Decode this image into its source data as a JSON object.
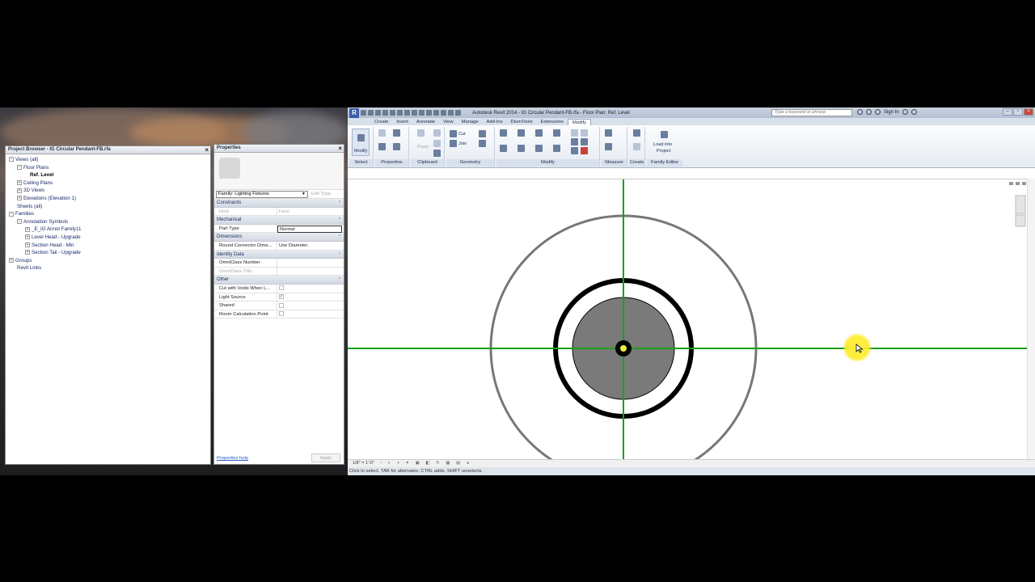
{
  "project_browser": {
    "title": "Project Browser - IG Circular Pendant-FB.rfa",
    "items": [
      {
        "label": "Views (all)",
        "exp": "−"
      },
      {
        "label": "Floor Plans",
        "exp": "−"
      },
      {
        "label": "Ref. Level",
        "exp": ""
      },
      {
        "label": "Ceiling Plans",
        "exp": "+"
      },
      {
        "label": "3D Views",
        "exp": "+"
      },
      {
        "label": "Elevations (Elevation 1)",
        "exp": "+"
      },
      {
        "label": "Sheets (all)",
        "exp": ""
      },
      {
        "label": "Families",
        "exp": "−"
      },
      {
        "label": "Annotation Symbols",
        "exp": "−"
      },
      {
        "label": "_E_IG Annot Family11",
        "exp": "+"
      },
      {
        "label": "Level Head - Upgrade",
        "exp": "+"
      },
      {
        "label": "Section Head - Min",
        "exp": "+"
      },
      {
        "label": "Section Tail - Upgrade",
        "exp": "+"
      },
      {
        "label": "Groups",
        "exp": "+"
      },
      {
        "label": "Revit Links",
        "exp": ""
      }
    ]
  },
  "properties": {
    "title": "Properties",
    "family_select": "Family: Lighting Fixtures",
    "edit_type": "Edit Type",
    "cat_constraints": "Constraints",
    "host_key": "Host",
    "host_val": "Face",
    "cat_mechanical": "Mechanical",
    "part_type_key": "Part Type",
    "part_type_val": "Normal",
    "cat_dimensions": "Dimensions",
    "round_key": "Round Connector Dime...",
    "round_val": "Use Diameter",
    "cat_identity": "Identity Data",
    "omni_num_key": "OmniClass Number",
    "omni_title_key": "OmniClass Title",
    "cat_other": "Other",
    "cut_voids_key": "Cut with Voids When L...",
    "light_source_key": "Light Source",
    "shared_key": "Shared",
    "room_calc_key": "Room Calculation Point",
    "help_link": "Properties help",
    "apply": "Apply"
  },
  "revit": {
    "title": "Autodesk Revit 2014 -    IG Circular Pendant-FB.rfa - Floor Plan: Ref. Level",
    "search_placeholder": "Type a keyword or phrase",
    "sign_in": "Sign In",
    "tabs": [
      "Create",
      "Insert",
      "Annotate",
      "View",
      "Manage",
      "Add-Ins",
      "DiumTools",
      "Extensions",
      "Modify"
    ],
    "ribbon": {
      "modify": "Modify",
      "cut": "Cut",
      "join": "Join",
      "paste": "Paste",
      "load_into": "Load into",
      "project": "Project",
      "groups": [
        "Select",
        "Properties",
        "Clipboard",
        "Geometry",
        "Modify",
        "Measure",
        "Create",
        "Family Editor"
      ]
    },
    "view_scale": "1/8\" = 1'-0\"",
    "status": "Click to select, TAB for alternates, CTRL adds, SHIFT unselects."
  }
}
